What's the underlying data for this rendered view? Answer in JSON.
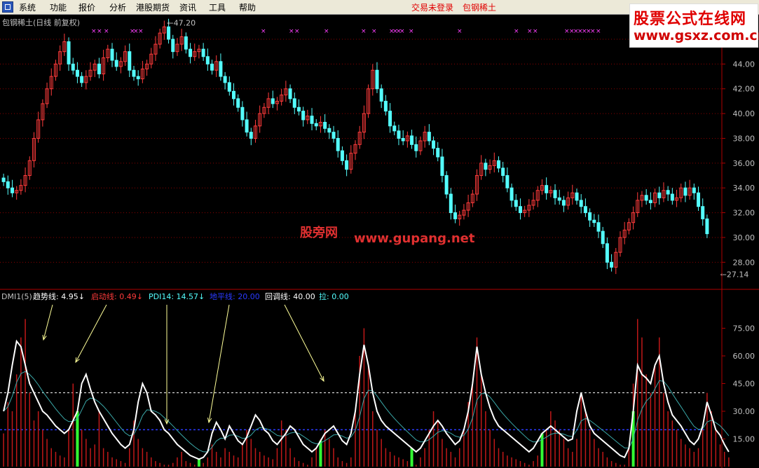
{
  "menu": {
    "items": [
      "系统",
      "功能",
      "报价",
      "分析",
      "港股期货",
      "资讯",
      "工具",
      "帮助"
    ],
    "status_login": "交易未登录",
    "status_stock": "包钢稀土"
  },
  "watermark_top": {
    "title": "股票公式在线网",
    "url": "www.gsxz.com.cn"
  },
  "watermark_mid": {
    "brand": "股旁网",
    "url": "www.gupang.net"
  },
  "colors": {
    "up": "#ff3b3b",
    "down": "#54ffff",
    "grid": "#8b0000",
    "dmi_line": "#ffffff",
    "green_bar": "#33ff33"
  },
  "chart_data": [
    {
      "type": "candlestick",
      "title": "包钢稀土(日线 前复权)",
      "ylim": [
        27,
        46
      ],
      "yticks": [
        "28.00",
        "30.00",
        "32.00",
        "34.00",
        "36.00",
        "38.00",
        "40.00",
        "42.00",
        "44.00",
        "46.00"
      ],
      "annotations": {
        "high": "47.20",
        "low": "27.14",
        "low_index": 166
      },
      "closes": [
        34.5,
        34.0,
        33.6,
        33.8,
        34.2,
        35.0,
        36.2,
        38.0,
        39.5,
        40.8,
        42.0,
        43.0,
        44.0,
        45.0,
        45.8,
        44.0,
        43.5,
        43.0,
        42.5,
        43.0,
        43.5,
        44.0,
        43.2,
        44.5,
        45.2,
        44.3,
        43.8,
        44.2,
        45.0,
        43.5,
        43.0,
        42.8,
        43.6,
        44.0,
        44.8,
        45.6,
        46.5,
        47.0,
        46.0,
        45.0,
        45.6,
        46.2,
        45.2,
        44.6,
        45.0,
        45.2,
        44.6,
        44.0,
        43.5,
        44.2,
        43.0,
        42.5,
        41.8,
        41.2,
        40.5,
        39.5,
        38.5,
        38.0,
        39.0,
        40.0,
        40.5,
        41.2,
        40.8,
        41.0,
        41.5,
        42.0,
        41.2,
        40.5,
        40.2,
        39.5,
        39.8,
        39.2,
        39.0,
        39.3,
        38.8,
        38.5,
        38.0,
        37.0,
        36.2,
        35.5,
        36.8,
        37.5,
        38.5,
        40.0,
        42.0,
        43.5,
        42.0,
        41.0,
        40.2,
        39.0,
        38.6,
        38.0,
        37.8,
        38.2,
        37.5,
        37.0,
        37.8,
        38.5,
        37.8,
        37.2,
        36.5,
        35.0,
        33.5,
        32.0,
        31.5,
        31.8,
        32.2,
        32.8,
        33.5,
        35.0,
        36.0,
        35.5,
        35.8,
        36.2,
        35.6,
        35.0,
        34.0,
        33.0,
        32.5,
        32.0,
        32.2,
        32.6,
        33.0,
        33.8,
        34.2,
        33.6,
        33.8,
        33.2,
        33.0,
        32.6,
        33.2,
        33.6,
        33.0,
        32.5,
        32.0,
        31.4,
        31.2,
        30.5,
        29.5,
        28.0,
        27.6,
        28.8,
        30.0,
        30.6,
        31.2,
        32.0,
        33.0,
        33.4,
        33.0,
        32.8,
        33.6,
        33.2,
        33.8,
        33.5,
        33.0,
        33.2,
        34.0,
        33.4,
        34.0,
        33.6,
        32.5,
        31.5,
        30.3
      ],
      "x_count": 168
    },
    {
      "type": "line+bar",
      "title": "DMI1(5)",
      "ylim": [
        0,
        90
      ],
      "yticks": [
        "15.00",
        "30.00",
        "45.00",
        "60.00",
        "75.00"
      ],
      "legend": [
        {
          "label": "趋势线",
          "value": "4.95",
          "color": "#ffffff"
        },
        {
          "label": "启动线",
          "value": "0.49",
          "color": "#ff3b3b"
        },
        {
          "label": "PDI14",
          "value": "14.57",
          "color": "#54ffff"
        },
        {
          "label": "地平线",
          "value": "20.00",
          "color": "#2a3aff"
        },
        {
          "label": "回调线",
          "value": "40.00",
          "color": "#ffffff"
        },
        {
          "label": "拉",
          "value": "0.00",
          "color": "#54ffff"
        }
      ],
      "levels": [
        20,
        40
      ],
      "trend": [
        30,
        40,
        55,
        68,
        65,
        55,
        45,
        40,
        35,
        30,
        28,
        25,
        22,
        20,
        18,
        20,
        25,
        30,
        45,
        50,
        42,
        35,
        30,
        26,
        22,
        18,
        15,
        12,
        10,
        12,
        20,
        35,
        45,
        40,
        30,
        28,
        25,
        20,
        18,
        15,
        12,
        10,
        8,
        6,
        5,
        4,
        5,
        8,
        18,
        24,
        20,
        15,
        22,
        18,
        14,
        12,
        16,
        22,
        28,
        25,
        20,
        18,
        14,
        12,
        15,
        18,
        22,
        20,
        16,
        12,
        10,
        8,
        10,
        14,
        18,
        20,
        22,
        18,
        14,
        12,
        18,
        30,
        50,
        66,
        55,
        40,
        30,
        25,
        22,
        20,
        18,
        16,
        14,
        12,
        10,
        8,
        10,
        14,
        18,
        22,
        25,
        22,
        18,
        15,
        12,
        14,
        20,
        30,
        45,
        65,
        50,
        40,
        32,
        26,
        22,
        20,
        18,
        16,
        14,
        12,
        10,
        8,
        10,
        14,
        18,
        20,
        22,
        20,
        18,
        16,
        14,
        15,
        30,
        40,
        30,
        22,
        18,
        16,
        14,
        12,
        10,
        8,
        6,
        5,
        10,
        30,
        55,
        50,
        48,
        45,
        55,
        60,
        45,
        35,
        28,
        25,
        22,
        18,
        14,
        12,
        15,
        22,
        35,
        28,
        20,
        17,
        12,
        8
      ],
      "bars": [
        18,
        35,
        30,
        50,
        70,
        80,
        40,
        25,
        30,
        20,
        15,
        10,
        8,
        6,
        5,
        20,
        45,
        30,
        20,
        15,
        10,
        12,
        30,
        10,
        8,
        5,
        4,
        3,
        2,
        10,
        25,
        15,
        10,
        8,
        5,
        3,
        2,
        1,
        1,
        2,
        5,
        8,
        3,
        2,
        1,
        1,
        2,
        5,
        12,
        8,
        5,
        10,
        8,
        6,
        5,
        12,
        20,
        15,
        10,
        8,
        6,
        5,
        4,
        10,
        25,
        20,
        10,
        5,
        3,
        2,
        1,
        5,
        10,
        15,
        20,
        15,
        10,
        5,
        3,
        2,
        5,
        30,
        60,
        75,
        55,
        30,
        20,
        15,
        10,
        8,
        6,
        5,
        4,
        3,
        2,
        1,
        5,
        10,
        20,
        30,
        25,
        15,
        10,
        8,
        5,
        10,
        20,
        35,
        45,
        70,
        50,
        30,
        20,
        15,
        10,
        8,
        6,
        5,
        4,
        3,
        2,
        1,
        3,
        6,
        10,
        20,
        30,
        25,
        20,
        15,
        10,
        8,
        15,
        40,
        30,
        20,
        15,
        10,
        8,
        5,
        3,
        2,
        1,
        1,
        10,
        45,
        80,
        70,
        50,
        40,
        55,
        70,
        40,
        30,
        25,
        20,
        15,
        12,
        10,
        8,
        10,
        20,
        40,
        30,
        20,
        12,
        8,
        5
      ],
      "green_indices": [
        17,
        45,
        73,
        94,
        124,
        145
      ]
    }
  ]
}
